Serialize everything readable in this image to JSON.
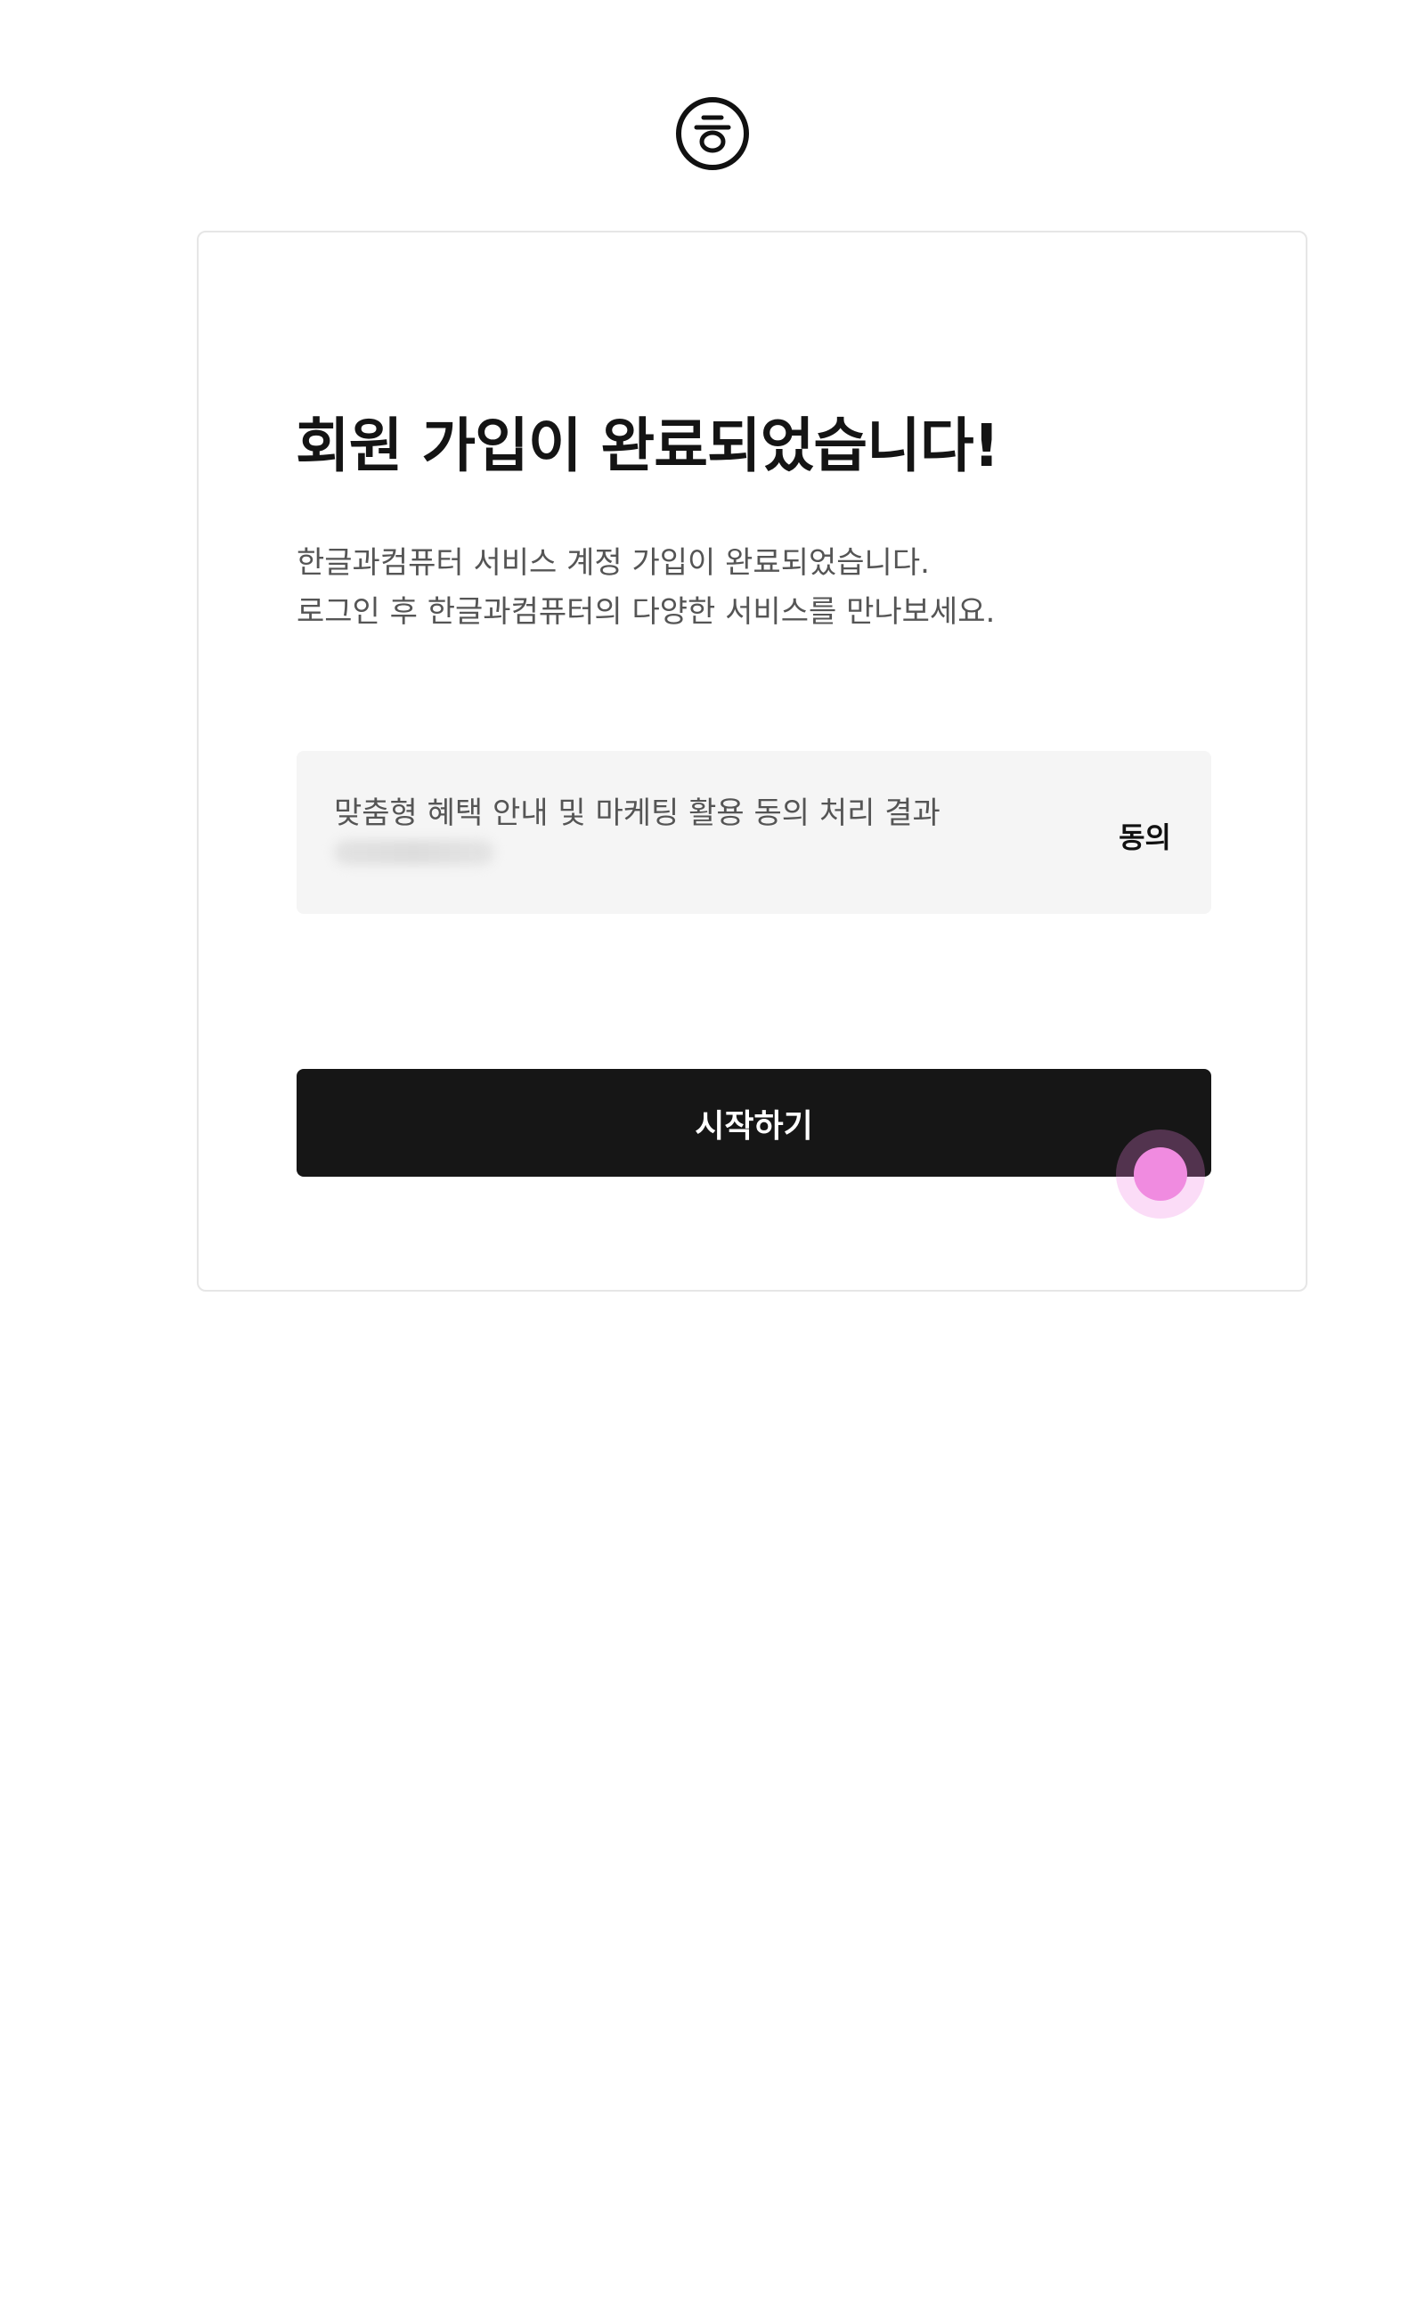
{
  "brand": {
    "logo_icon": "hangul-hieut-logo-icon"
  },
  "signup_complete": {
    "title": "회원 가입이 완료되었습니다!",
    "description_line1": "한글과컴퓨터 서비스 계정 가입이 완료되었습니다.",
    "description_line2": "로그인 후 한글과컴퓨터의 다양한 서비스를 만나보세요.",
    "marketing_consent": {
      "label": "맞춤형 혜택 안내 및 마케팅 활용 동의 처리 결과",
      "status": "동의"
    },
    "start_button_label": "시작하기"
  },
  "colors": {
    "button_bg": "#161616",
    "agree_box_bg": "#f5f5f5",
    "cursor": "#f08be0"
  }
}
